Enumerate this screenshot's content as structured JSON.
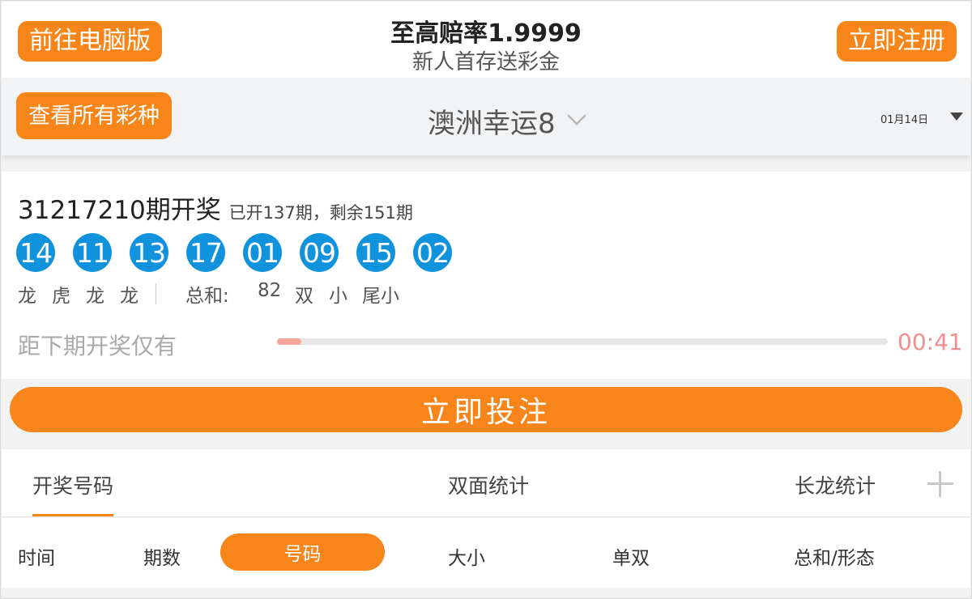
{
  "header": {
    "pc_button": "前往电脑版",
    "promo_title": "至高赔率1.9999",
    "promo_subtitle": "新人首存送彩金",
    "register_button": "立即注册"
  },
  "selector": {
    "all_lotteries_button": "查看所有彩种",
    "lottery_name": "澳洲幸运8",
    "date": "01月14日"
  },
  "result": {
    "issue": "31217210期开奖",
    "issue_info": "已开137期，剩余151期",
    "balls": [
      "14",
      "11",
      "13",
      "17",
      "01",
      "09",
      "15",
      "02"
    ],
    "dragon_tiger": [
      "龙",
      "虎",
      "龙",
      "龙"
    ],
    "sum_label": "总和:",
    "sum_value": "82",
    "sum_odd_even": "双",
    "sum_size": "小",
    "tail_size": "尾小",
    "countdown_label": "距下期开奖仅有",
    "countdown_time": "00:41",
    "progress_percent": 4
  },
  "bet_button": "立即投注",
  "tabs": [
    "开奖号码",
    "双面统计",
    "长龙统计"
  ],
  "filters": {
    "time": "时间",
    "issue": "期数",
    "number": "号码",
    "size": "大小",
    "odd_even": "单双",
    "sum_shape": "总和/形态"
  },
  "colors": {
    "accent": "#f7851a",
    "ball": "#1192dc",
    "countdown": "#f58d8d"
  }
}
